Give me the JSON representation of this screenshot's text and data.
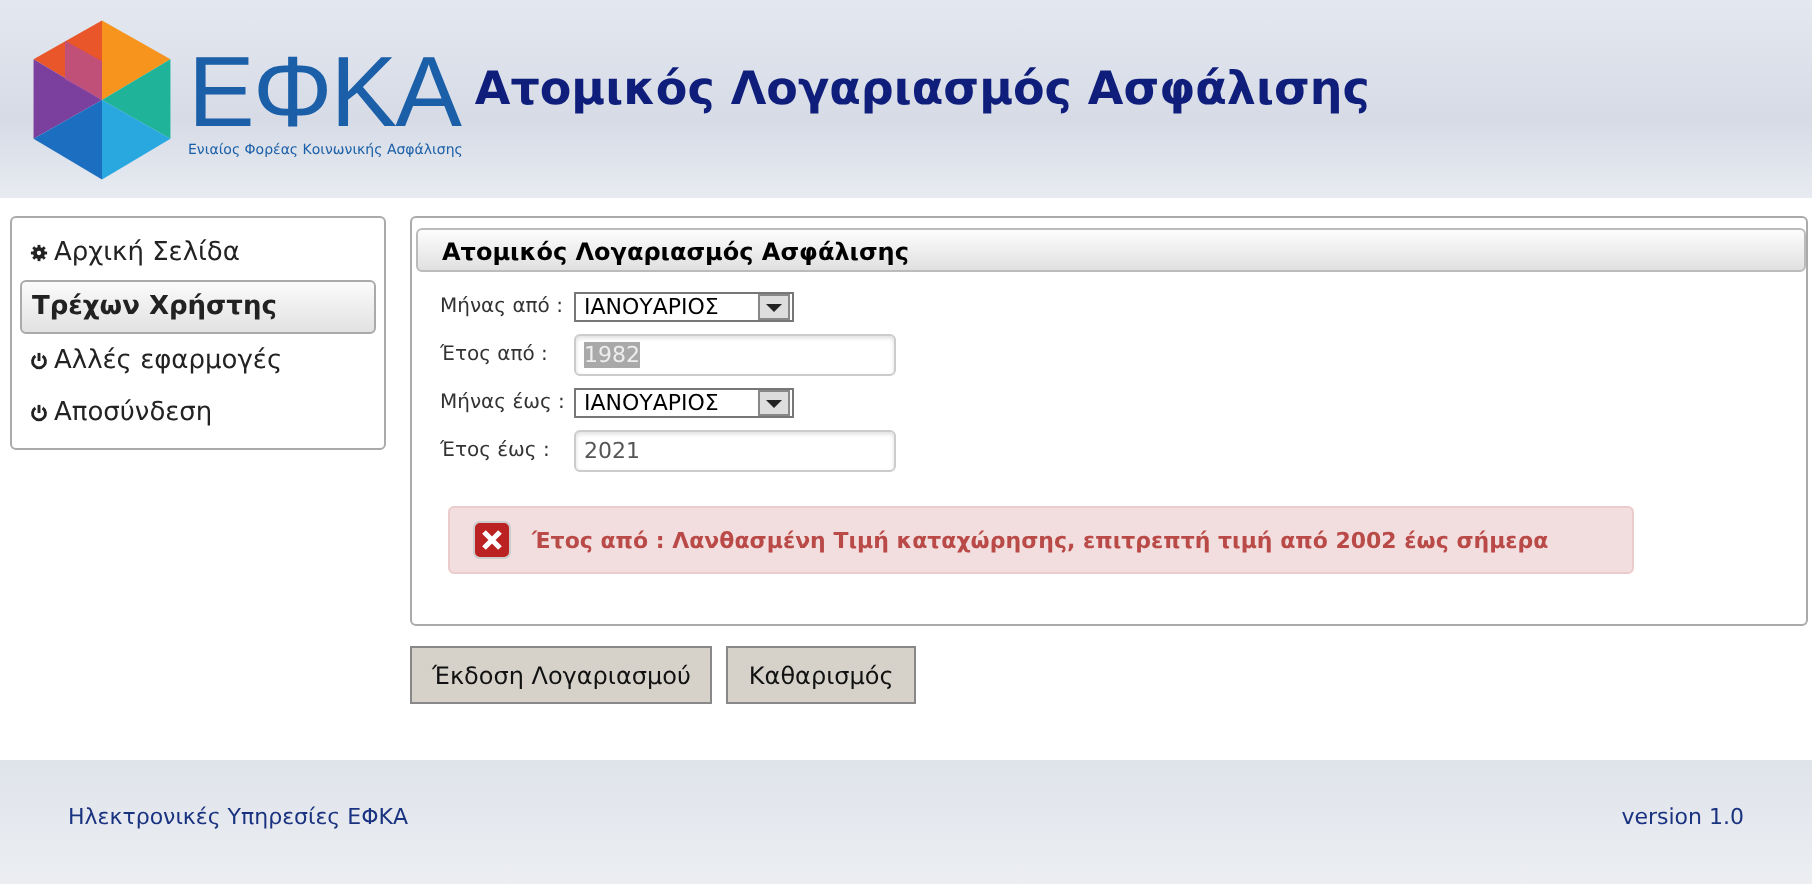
{
  "header": {
    "logo_text": "ΕΦΚΑ",
    "logo_subtitle": "Ενιαίος Φορέας Κοινωνικής Ασφάλισης",
    "title": "Ατομικός Λογαριασμός Ασφάλισης"
  },
  "sidebar": {
    "items": [
      {
        "label": "Αρχική Σελίδα",
        "kind": "home",
        "selected": false
      },
      {
        "label": "Τρέχων Χρήστης",
        "kind": "heading",
        "selected": true
      },
      {
        "label": "Αλλές εφαρμογές",
        "kind": "app",
        "selected": false
      },
      {
        "label": "Αποσύνδεση",
        "kind": "app",
        "selected": false
      }
    ]
  },
  "panel": {
    "title": "Ατομικός Λογαριασμός Ασφάλισης",
    "fields": [
      {
        "kind": "select",
        "label": "Μήνας από :",
        "value": "ΙΑΝΟΥΑΡΙΟΣ"
      },
      {
        "kind": "text",
        "label": "Έτος από :",
        "value": "1982",
        "text_selected": true
      },
      {
        "kind": "select",
        "label": "Μήνας έως :",
        "value": "ΙΑΝΟΥΑΡΙΟΣ"
      },
      {
        "kind": "text",
        "label": "Έτος έως :",
        "value": "2021",
        "text_selected": false
      }
    ],
    "error": "Έτος από : Λανθασμένη Τιμή καταχώρησης, επιτρεπτή τιμή από 2002 έως σήμερα"
  },
  "buttons": [
    "Έκδοση Λογαριασμού",
    "Καθαρισμός"
  ],
  "footer": {
    "left": "Ηλεκτρονικές Υπηρεσίες ΕΦΚΑ",
    "right": "version 1.0"
  }
}
